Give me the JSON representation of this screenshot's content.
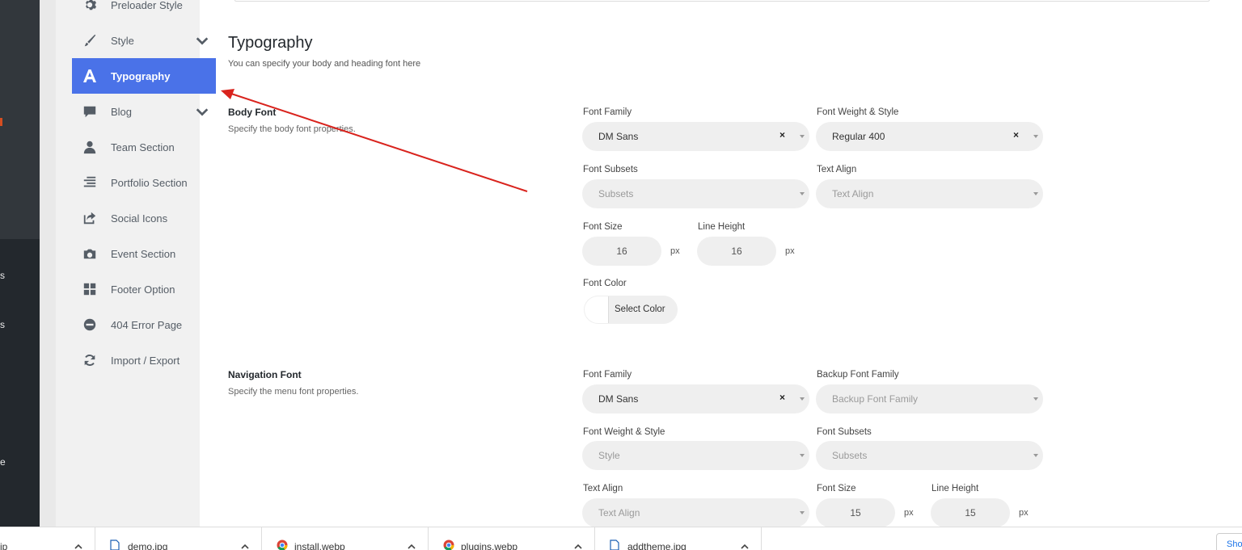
{
  "wp_strip": {
    "fragments": [
      "s",
      "s",
      "e"
    ]
  },
  "sidebar": {
    "items": [
      {
        "label": "Preloader Style",
        "icon": "gear-icon"
      },
      {
        "label": "Style",
        "icon": "brush-icon"
      },
      {
        "label": "Typography",
        "icon": "font-icon"
      },
      {
        "label": "Blog",
        "icon": "comment-icon"
      },
      {
        "label": "Team Section",
        "icon": "user-icon"
      },
      {
        "label": "Portfolio Section",
        "icon": "align-icon"
      },
      {
        "label": "Social Icons",
        "icon": "share-icon"
      },
      {
        "label": "Event Section",
        "icon": "camera-icon"
      },
      {
        "label": "Footer Option",
        "icon": "grid-icon"
      },
      {
        "label": "404 Error Page",
        "icon": "minus-circle-icon"
      },
      {
        "label": "Import / Export",
        "icon": "refresh-icon"
      }
    ],
    "active_index": 2,
    "active_color": "#4a72e8"
  },
  "main": {
    "title": "Typography",
    "subtitle": "You can specify your body and heading font here",
    "body_font": {
      "title": "Body Font",
      "desc": "Specify the body font properties.",
      "family_label": "Font Family",
      "family_value": "DM Sans",
      "weight_label": "Font Weight & Style",
      "weight_value": "Regular 400",
      "subsets_label": "Font Subsets",
      "subsets_placeholder": "Subsets",
      "align_label": "Text Align",
      "align_placeholder": "Text Align",
      "size_label": "Font Size",
      "size_value": "16",
      "line_label": "Line Height",
      "line_value": "16",
      "unit": "px",
      "color_label": "Font Color",
      "color_button": "Select Color"
    },
    "nav_font": {
      "title": "Navigation Font",
      "desc": "Specify the menu font properties.",
      "family_label": "Font Family",
      "family_value": "DM Sans",
      "backup_label": "Backup Font Family",
      "backup_placeholder": "Backup Font Family",
      "weight_label": "Font Weight & Style",
      "weight_placeholder": "Style",
      "subsets_label": "Font Subsets",
      "subsets_placeholder": "Subsets",
      "align_label": "Text Align",
      "align_placeholder": "Text Align",
      "size_label": "Font Size",
      "size_value": "15",
      "line_label": "Line Height",
      "line_value": "15",
      "unit": "px"
    },
    "clear_glyph": "×"
  },
  "downloads": {
    "items": [
      {
        "name": "ip"
      },
      {
        "name": "demo.jpg"
      },
      {
        "name": "install.webp"
      },
      {
        "name": "plugins.webp"
      },
      {
        "name": "addtheme.jpg"
      }
    ],
    "show_all": "Sho"
  },
  "annotation": {
    "color": "#d9231d"
  }
}
